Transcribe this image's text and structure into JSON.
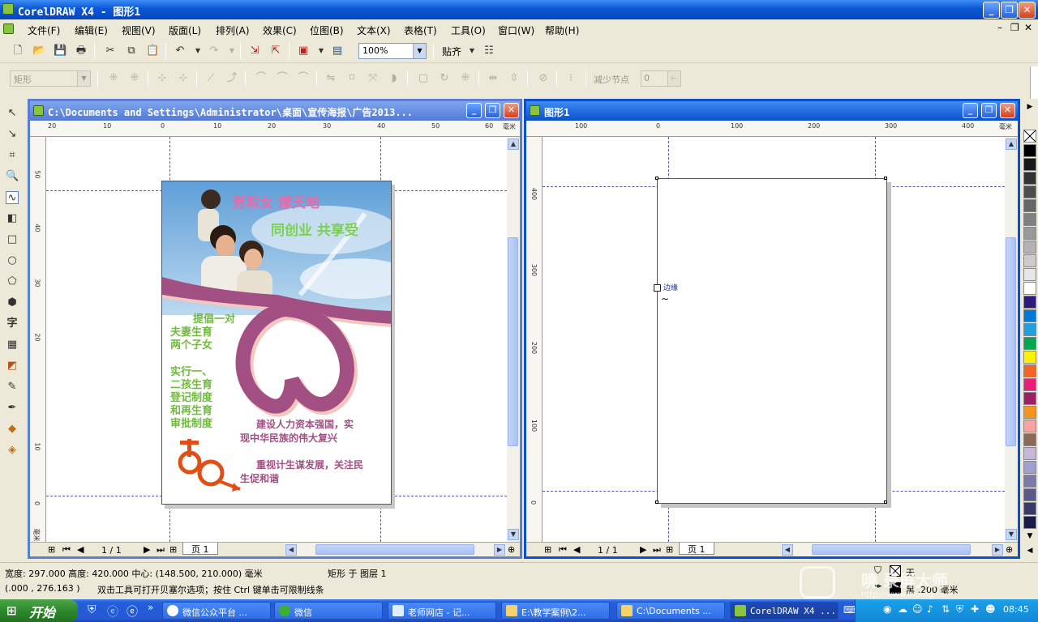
{
  "app": {
    "title": "CorelDRAW X4 - 图形1"
  },
  "menu": [
    "文件(F)",
    "编辑(E)",
    "视图(V)",
    "版面(L)",
    "排列(A)",
    "效果(C)",
    "位图(B)",
    "文本(X)",
    "表格(T)",
    "工具(O)",
    "窗口(W)",
    "帮助(H)"
  ],
  "toolbar": {
    "zoom": "100%",
    "snap_label": "贴齐"
  },
  "propbar": {
    "object_type": "矩形",
    "reduce_nodes_label": "减少节点",
    "reduce_nodes_value": "0"
  },
  "doc1": {
    "title": "C:\\Documents and Settings\\Administrator\\桌面\\宣传海报\\广告2013...",
    "hruler": [
      "20",
      "10",
      "0",
      "10",
      "20",
      "30",
      "40",
      "50",
      "60",
      "毫米"
    ],
    "vruler": [
      "50",
      "40",
      "30",
      "20",
      "10",
      "0",
      "毫米"
    ],
    "page_info": "1 / 1",
    "page_tab": "页 1"
  },
  "poster": {
    "headline1": "男和女  撑天地",
    "headline2": "同创业  共享受",
    "left_text1": [
      "提倡一对",
      "夫妻生育",
      "两个子女"
    ],
    "left_text2": [
      "实行一、",
      "二孩生育",
      "登记制度",
      "和再生育",
      "审批制度"
    ],
    "slogan1": [
      "建设人力资本强国，实",
      "现中华民族的伟大复兴"
    ],
    "slogan2": [
      "重视计生谋发展，关注民",
      "生促和谐"
    ]
  },
  "doc2": {
    "title": "图形1",
    "hruler": [
      "100",
      "0",
      "100",
      "200",
      "300",
      "400",
      "毫米"
    ],
    "vruler": [
      "400",
      "300",
      "200",
      "100",
      "0"
    ],
    "page_info": "1 / 1",
    "page_tab": "页 1",
    "cursor_label": "边缘"
  },
  "status": {
    "dims": "宽度: 297.000  高度: 420.000  中心: (148.500, 210.000)  毫米",
    "object": "矩形 于 图层 1",
    "coords": "(.000 , 276.163 )",
    "hint": "双击工具可打开贝塞尔选项；按住 Ctrl 键单击可限制线条",
    "fill": "无",
    "outline": "黑  .200 毫米"
  },
  "taskbar": {
    "start": "开始",
    "items": [
      "微信公众平台 ...",
      "微信",
      "老师网店 - 记...",
      "E:\\教学案例\\2...",
      "C:\\Documents ...",
      "CorelDRAW X4 ..."
    ],
    "time": "08:45"
  },
  "watermark": {
    "line1": "曉 录屏大师",
    "line2": "http://www.luping.com"
  },
  "palette_colors": [
    "#000000",
    "#1a1a1a",
    "#333333",
    "#4d4d4d",
    "#666666",
    "#808080",
    "#999999",
    "#b3b3b3",
    "#cccccc",
    "#e6e6e6",
    "#ffffff",
    "#2e1a7a",
    "#0078d7",
    "#1fa0e0",
    "#00a651",
    "#fff200",
    "#f26522",
    "#ed1c79",
    "#9e1f63",
    "#f7941d",
    "#f8a2a2",
    "#8b6a5a",
    "#c7b8d8",
    "#a0a0d0",
    "#7a7aa8",
    "#5a5a88",
    "#3a3a68",
    "#1a1a48"
  ]
}
